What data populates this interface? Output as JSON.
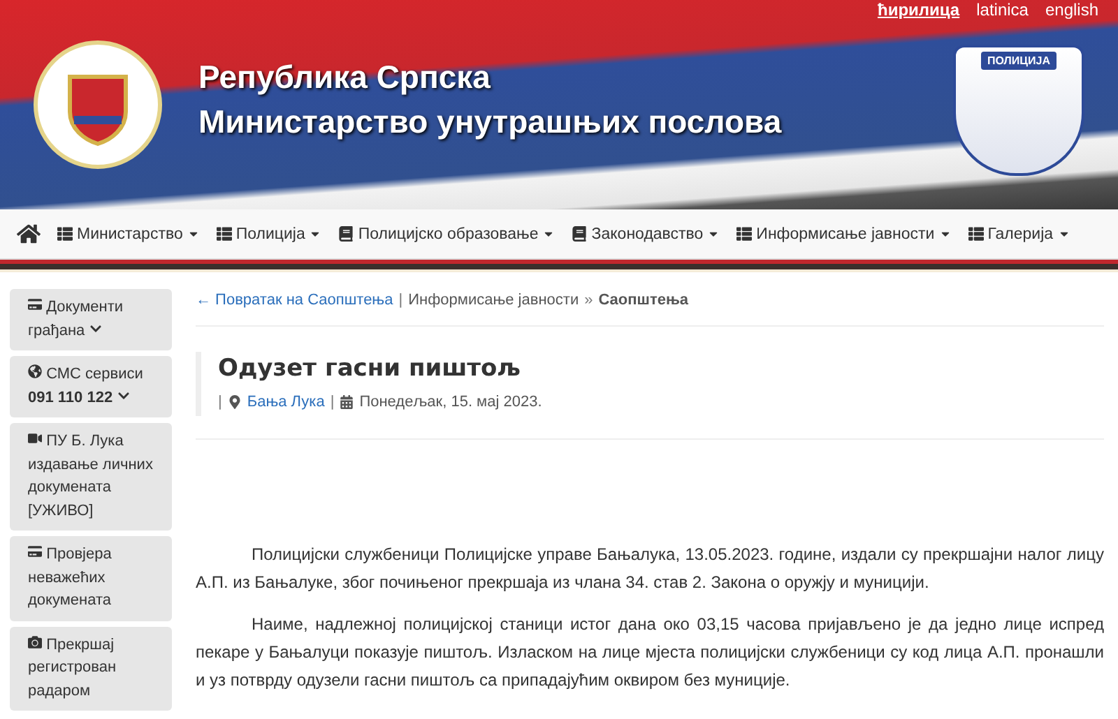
{
  "languages": [
    {
      "label": "ћирилица",
      "selected": true
    },
    {
      "label": "latinica",
      "selected": false
    },
    {
      "label": "english",
      "selected": false
    }
  ],
  "header": {
    "title": "Република Српска",
    "subtitle": "Министарство унутрашњих послова",
    "badge_text": "ПОЛИЦИЈА"
  },
  "nav": [
    {
      "label": "Министарство",
      "kind": "list"
    },
    {
      "label": "Полиција",
      "kind": "list"
    },
    {
      "label": "Полицијско образовање",
      "kind": "book"
    },
    {
      "label": "Законодавство",
      "kind": "book"
    },
    {
      "label": "Информисање јавности",
      "kind": "list"
    },
    {
      "label": "Галерија",
      "kind": "list"
    }
  ],
  "sidebar": [
    {
      "kind": "card",
      "lines": [
        "Документи",
        "грађана"
      ]
    },
    {
      "kind": "globe",
      "lines": [
        "СМС сервиси"
      ],
      "phone": "091 110 122"
    },
    {
      "kind": "video",
      "lines": [
        "ПУ Б. Лука",
        "издавање личних",
        "докумената",
        "[УЖИВО]"
      ]
    },
    {
      "kind": "card",
      "lines": [
        "Провјера",
        "неважећих",
        "докумената"
      ]
    },
    {
      "kind": "camera",
      "lines": [
        "Прекршај",
        "регистрован",
        "радаром"
      ]
    }
  ],
  "breadcrumb": {
    "back": "← Повратак на Саопштења",
    "separator_1": "|",
    "section": "Информисање јавности",
    "separator_2": "»",
    "current": "Саопштења"
  },
  "article": {
    "title": "Одузет гасни пиштољ",
    "meta_separators": [
      "|",
      "|"
    ],
    "location": "Бања Лука",
    "date": "Понедељак, 15. мај 2023.",
    "paragraphs": [
      "Полицијски службеници Полицијске управе Бањалука, 13.05.2023. године, издали су прекршајни налог лицу А.П. из Бањалуке, због почињеног прекршаја из члана 34. став 2. Закона о оружју и муницији.",
      "Наиме, надлежној полицијској станици истог дана око 03,15 часова пријављено је да једно лице испред пекаре у Бањалуци показује пиштољ. Изласком на лице мјеста полицијски службеници су код лица А.П. пронашли и уз потврду одузели гасни пиштољ са припадајућим оквиром без муниције."
    ]
  }
}
